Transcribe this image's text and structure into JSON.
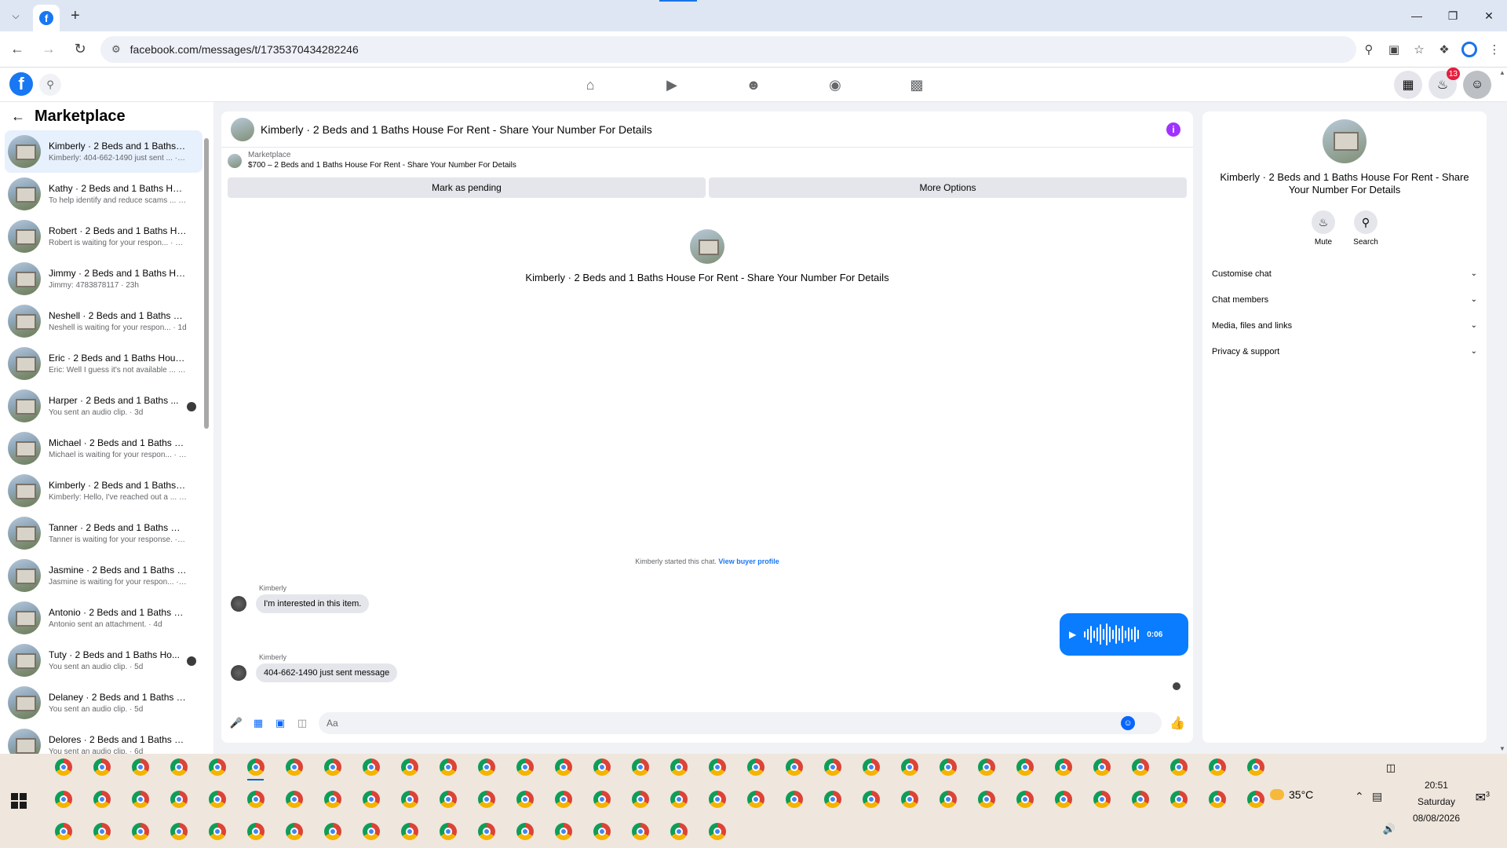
{
  "browser": {
    "url": "facebook.com/messages/t/1735370434282246",
    "new_tab": "+"
  },
  "fbnav": {
    "notifications_count": "13"
  },
  "left": {
    "title": "Marketplace",
    "conversations": [
      {
        "name": "Kimberly · 2 Beds and 1 Baths H...",
        "preview": "Kimberly: 404-662-1490 just sent ... · 1m",
        "active": true
      },
      {
        "name": "Kathy · 2 Beds and 1 Baths Hou...",
        "preview": "To help identify and reduce scams ... · 3h"
      },
      {
        "name": "Robert · 2 Beds and 1 Baths Ho...",
        "preview": "Robert is waiting for your respon... · 14h"
      },
      {
        "name": "Jimmy · 2 Beds and 1 Baths Hou...",
        "preview": "Jimmy: 4783878117 · 23h"
      },
      {
        "name": "Neshell · 2 Beds and 1 Baths Ho...",
        "preview": "Neshell is waiting for your respon... · 1d"
      },
      {
        "name": "Eric · 2 Beds and 1 Baths House ...",
        "preview": "Eric: Well I guess it's not available ... · 1d"
      },
      {
        "name": "Harper · 2 Beds and 1 Baths ...",
        "preview": "You sent an audio clip. · 3d",
        "seen": true
      },
      {
        "name": "Michael · 2 Beds and 1 Baths Ho...",
        "preview": "Michael is waiting for your respon... · 3d"
      },
      {
        "name": "Kimberly · 2 Beds and 1 Baths H...",
        "preview": "Kimberly: Hello, I've reached out a ... · 3d"
      },
      {
        "name": "Tanner · 2 Beds and 1 Baths Ho...",
        "preview": "Tanner is waiting for your response. · 4d"
      },
      {
        "name": "Jasmine · 2 Beds and 1 Baths H...",
        "preview": "Jasmine is waiting for your respon... · 4d"
      },
      {
        "name": "Antonio · 2 Beds and 1 Baths H...",
        "preview": "Antonio sent an attachment. · 4d"
      },
      {
        "name": "Tuty · 2 Beds and 1 Baths Ho...",
        "preview": "You sent an audio clip. · 5d",
        "seen": true
      },
      {
        "name": "Delaney · 2 Beds and 1 Baths H...",
        "preview": "You sent an audio clip. · 5d"
      },
      {
        "name": "Delores · 2 Beds and 1 Baths Ho...",
        "preview": "You sent an audio clip. · 6d"
      }
    ]
  },
  "chat": {
    "title": "Kimberly · 2 Beds and 1 Baths House For Rent - Share Your Number For Details",
    "marketplace_label": "Marketplace",
    "listing": "$700 – 2 Beds and 1 Baths House For Rent - Share Your Number For Details",
    "mark_pending": "Mark as pending",
    "more_options": "More Options",
    "intro_title": "Kimberly · 2 Beds and 1 Baths House For Rent - Share Your Number For Details",
    "started_text": "Kimberly started this chat.",
    "view_profile": "View buyer profile",
    "msg1_sender": "Kimberly",
    "msg1_text": "I'm interested in this item.",
    "audio_duration": "0:06",
    "msg2_sender": "Kimberly",
    "msg2_text": "404-662-1490 just sent message",
    "composer_placeholder": "Aa"
  },
  "info": {
    "title": "Kimberly · 2 Beds and 1 Baths House For Rent - Share Your Number For Details",
    "mute": "Mute",
    "search": "Search",
    "sections": [
      "Customise chat",
      "Chat members",
      "Media, files and links",
      "Privacy & support"
    ]
  },
  "taskbar": {
    "temperature": "35°C",
    "time": "20:51",
    "day": "Saturday",
    "date": "08/08/2026",
    "notifications": "3"
  }
}
